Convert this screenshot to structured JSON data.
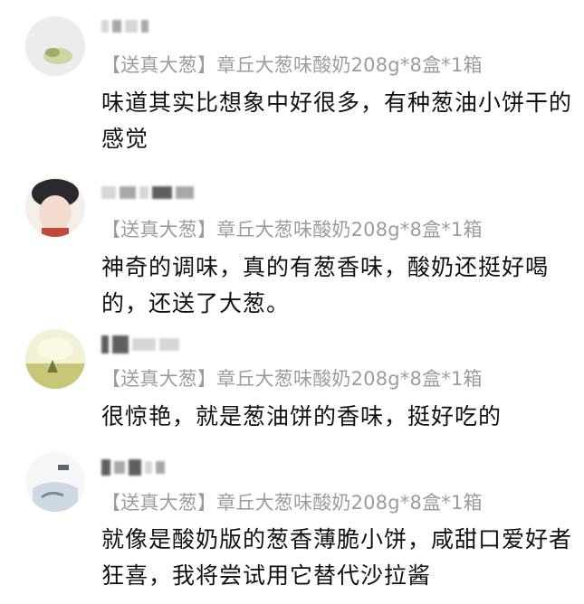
{
  "comments": [
    {
      "product": "【送真大葱】章丘大葱味酸奶208g*8盒*1箱",
      "text": "味道其实比想象中好很多，有种葱油小饼干的感觉",
      "avatar_color": "#e6e6d8"
    },
    {
      "product": "【送真大葱】章丘大葱味酸奶208g*8盒*1箱",
      "text": "神奇的调味，真的有葱香味，酸奶还挺好喝的，还送了大葱。",
      "avatar_color": "#f2d9cf"
    },
    {
      "product": "【送真大葱】章丘大葱味酸奶208g*8盒*1箱",
      "text": "很惊艳，就是葱油饼的香味，挺好吃的",
      "avatar_color": "#e5e0b8"
    },
    {
      "product": "【送真大葱】章丘大葱味酸奶208g*8盒*1箱",
      "text": "就像是酸奶版的葱香薄脆小饼，咸甜口爱好者狂喜，我将尝试用它替代沙拉酱",
      "avatar_color": "#d9e2ea"
    }
  ]
}
